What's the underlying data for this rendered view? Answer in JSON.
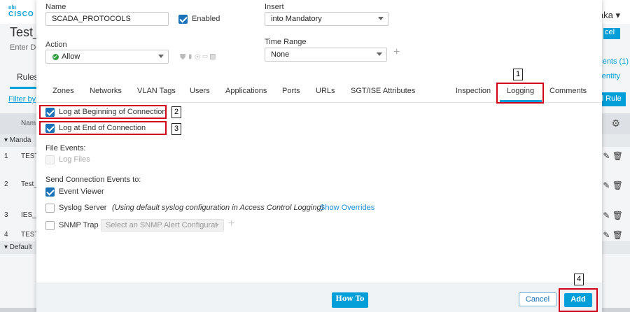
{
  "background": {
    "brand": "CISCO",
    "title": "Test_",
    "enter_text": "Enter De",
    "user_text": "aka ▾",
    "cancel_text": "cel",
    "comments_link": "nents (1)",
    "identity_link": "entity",
    "rules_tab": "Rules",
    "filter_link": "Filter by",
    "add_rule_button": "d Rule",
    "name_column": "Nam",
    "group_mandatory": "▾  Manda",
    "group_default": "▾  Default",
    "rows": [
      {
        "num": "1",
        "name": "TEST"
      },
      {
        "num": "2",
        "name": "Test_"
      },
      {
        "num": "3",
        "name": "IES_I"
      },
      {
        "num": "4",
        "name": "TEST"
      }
    ]
  },
  "form": {
    "name_label": "Name",
    "name_value": "SCADA_PROTOCOLS",
    "enabled_label": "Enabled",
    "enabled_checked": true,
    "insert_label": "Insert",
    "insert_value": "into Mandatory",
    "action_label": "Action",
    "action_value": "Allow",
    "time_range_label": "Time Range",
    "time_range_value": "None"
  },
  "tabs": [
    {
      "label": "Zones"
    },
    {
      "label": "Networks"
    },
    {
      "label": "VLAN Tags"
    },
    {
      "label": "Users"
    },
    {
      "label": "Applications"
    },
    {
      "label": "Ports"
    },
    {
      "label": "URLs"
    },
    {
      "label": "SGT/ISE Attributes"
    },
    {
      "label": "Inspection"
    },
    {
      "label": "Logging"
    },
    {
      "label": "Comments"
    }
  ],
  "active_tab": "Logging",
  "logging": {
    "log_begin_label": "Log at Beginning of Connection",
    "log_begin_checked": true,
    "log_end_label": "Log at End of Connection",
    "log_end_checked": true,
    "file_events_label": "File Events:",
    "log_files_label": "Log Files",
    "send_events_label": "Send Connection Events to:",
    "event_viewer_label": "Event Viewer",
    "event_viewer_checked": true,
    "syslog_label": "Syslog Server",
    "syslog_checked": false,
    "syslog_note": "(Using default syslog configuration in Access Control Logging)",
    "show_overrides_link": "Show Overrides",
    "snmp_label": "SNMP Trap",
    "snmp_checked": false,
    "snmp_placeholder": "Select an SNMP Alert Configurat"
  },
  "footer": {
    "how_to": "How To",
    "cancel": "Cancel",
    "add": "Add"
  },
  "annotations": [
    "1",
    "2",
    "3",
    "4"
  ],
  "colors": {
    "accent": "#049fd9",
    "checkbox": "#1a73b8",
    "highlight": "#d0021b",
    "allow_green": "#2e9e3f"
  }
}
